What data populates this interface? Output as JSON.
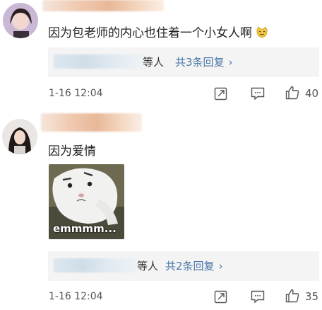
{
  "comments": [
    {
      "text": "因为包老师的内心也住着一个小女人啊",
      "emoji": "cat-emoji",
      "reply": {
        "tail": "等人",
        "count_label": "共3条回复",
        "chevron": "›"
      },
      "time": "1-16 12:04",
      "likes": "40"
    },
    {
      "text": "因为爱情",
      "sticker_caption": "emmmm...",
      "reply": {
        "tail": "等人",
        "count_label": "共2条回复",
        "chevron": "›"
      },
      "time": "1-16 12:04",
      "likes": "35"
    }
  ],
  "icons": {
    "share": "share-icon",
    "comment": "comment-icon",
    "like": "thumbs-up-icon"
  },
  "colors": {
    "link_blue": "#4a76a8",
    "reply_bg": "#f4f4f4"
  }
}
